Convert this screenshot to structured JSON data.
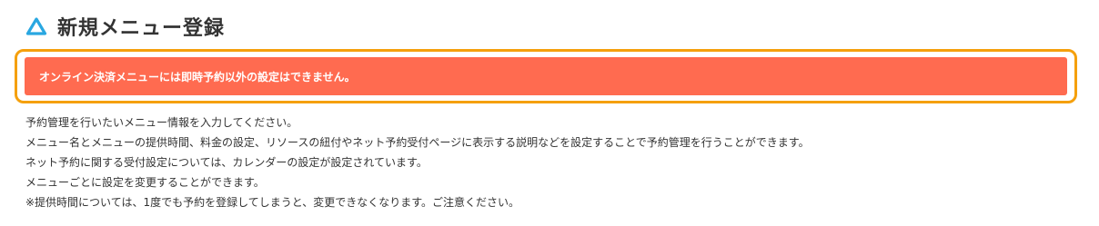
{
  "header": {
    "title": "新規メニュー登録",
    "icon": "triangle-logo-icon",
    "icon_color": "#29a7e1"
  },
  "alert": {
    "message": "オンライン決済メニューには即時予約以外の設定はできません。",
    "background_color": "#ff6b50",
    "highlight_border_color": "#f5a00d"
  },
  "description": {
    "lines": [
      "予約管理を行いたいメニュー情報を入力してください。",
      "メニュー名とメニューの提供時間、料金の設定、リソースの紐付やネット予約受付ページに表示する説明などを設定することで予約管理を行うことができます。",
      "ネット予約に関する受付設定については、カレンダーの設定が設定されています。",
      "メニューごとに設定を変更することができます。",
      "※提供時間については、1度でも予約を登録してしまうと、変更できなくなります。ご注意ください。"
    ]
  }
}
